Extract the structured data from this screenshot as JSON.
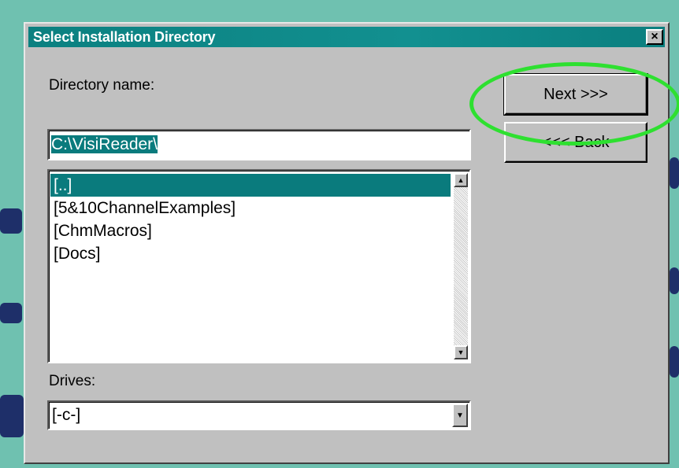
{
  "window": {
    "title": "Select Installation Directory",
    "close_glyph": "×"
  },
  "directory": {
    "label": "Directory name:",
    "value": "C:\\VisiReader\\"
  },
  "folder_list": {
    "items": [
      {
        "label": "[..]",
        "selected": true
      },
      {
        "label": "[5&10ChannelExamples]",
        "selected": false
      },
      {
        "label": "[ChmMacros]",
        "selected": false
      },
      {
        "label": "[Docs]",
        "selected": false
      }
    ],
    "scroll_up_glyph": "▲",
    "scroll_down_glyph": "▼"
  },
  "drives": {
    "label": "Drives:",
    "value": "[-c-]",
    "arrow_glyph": "▼"
  },
  "buttons": {
    "next_label": "Next >>>",
    "back_label": "<<< Back"
  },
  "colors": {
    "desktop": "#6fc1b0",
    "titlebar": "#0b8080",
    "selection": "#0a7b7d",
    "highlight_ring": "#2ee030",
    "dialog_face": "#c0c0c0"
  },
  "icons": [
    "close-icon",
    "scroll-up-arrow-icon",
    "scroll-down-arrow-icon",
    "dropdown-arrow-icon"
  ]
}
